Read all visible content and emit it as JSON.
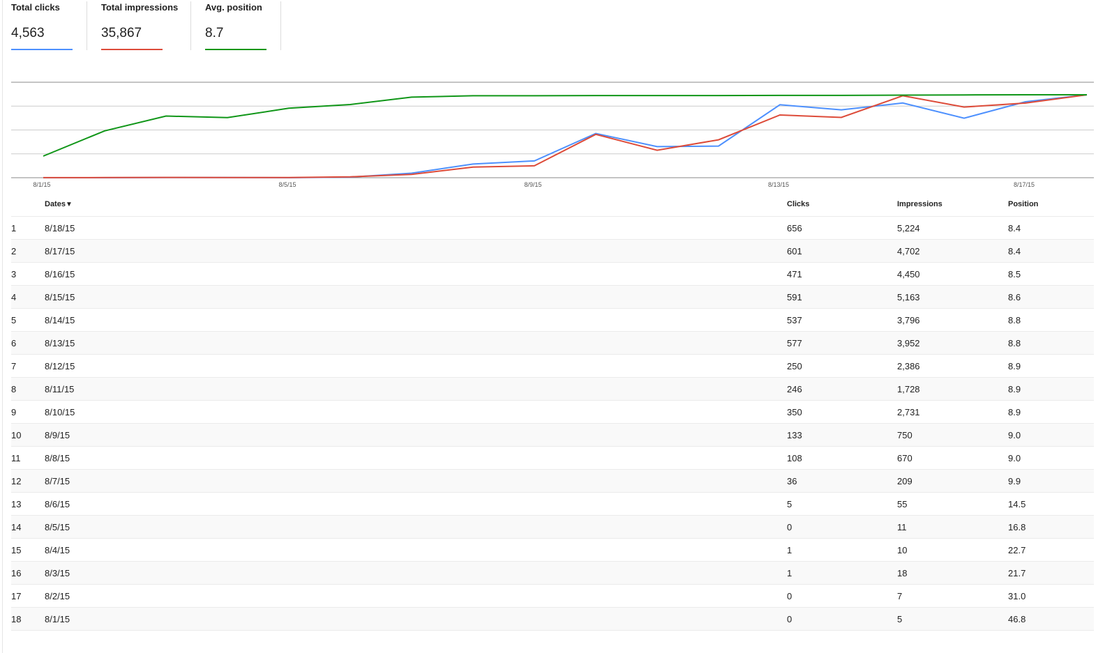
{
  "metrics": [
    {
      "label": "Total clicks",
      "value": "4,563",
      "color": "#4d90fe"
    },
    {
      "label": "Total impressions",
      "value": "35,867",
      "color": "#dd4b39"
    },
    {
      "label": "Avg. position",
      "value": "8.7",
      "color": "#109618"
    }
  ],
  "table": {
    "headers": {
      "dates": "Dates",
      "sort_indicator": "▼",
      "clicks": "Clicks",
      "impressions": "Impressions",
      "position": "Position"
    },
    "rows": [
      {
        "idx": "1",
        "date": "8/18/15",
        "clicks": "656",
        "impressions": "5,224",
        "position": "8.4"
      },
      {
        "idx": "2",
        "date": "8/17/15",
        "clicks": "601",
        "impressions": "4,702",
        "position": "8.4"
      },
      {
        "idx": "3",
        "date": "8/16/15",
        "clicks": "471",
        "impressions": "4,450",
        "position": "8.5"
      },
      {
        "idx": "4",
        "date": "8/15/15",
        "clicks": "591",
        "impressions": "5,163",
        "position": "8.6"
      },
      {
        "idx": "5",
        "date": "8/14/15",
        "clicks": "537",
        "impressions": "3,796",
        "position": "8.8"
      },
      {
        "idx": "6",
        "date": "8/13/15",
        "clicks": "577",
        "impressions": "3,952",
        "position": "8.8"
      },
      {
        "idx": "7",
        "date": "8/12/15",
        "clicks": "250",
        "impressions": "2,386",
        "position": "8.9"
      },
      {
        "idx": "8",
        "date": "8/11/15",
        "clicks": "246",
        "impressions": "1,728",
        "position": "8.9"
      },
      {
        "idx": "9",
        "date": "8/10/15",
        "clicks": "350",
        "impressions": "2,731",
        "position": "8.9"
      },
      {
        "idx": "10",
        "date": "8/9/15",
        "clicks": "133",
        "impressions": "750",
        "position": "9.0"
      },
      {
        "idx": "11",
        "date": "8/8/15",
        "clicks": "108",
        "impressions": "670",
        "position": "9.0"
      },
      {
        "idx": "12",
        "date": "8/7/15",
        "clicks": "36",
        "impressions": "209",
        "position": "9.9"
      },
      {
        "idx": "13",
        "date": "8/6/15",
        "clicks": "5",
        "impressions": "55",
        "position": "14.5"
      },
      {
        "idx": "14",
        "date": "8/5/15",
        "clicks": "0",
        "impressions": "11",
        "position": "16.8"
      },
      {
        "idx": "15",
        "date": "8/4/15",
        "clicks": "1",
        "impressions": "10",
        "position": "22.7"
      },
      {
        "idx": "16",
        "date": "8/3/15",
        "clicks": "1",
        "impressions": "18",
        "position": "21.7"
      },
      {
        "idx": "17",
        "date": "8/2/15",
        "clicks": "0",
        "impressions": "7",
        "position": "31.0"
      },
      {
        "idx": "18",
        "date": "8/1/15",
        "clicks": "0",
        "impressions": "5",
        "position": "46.8"
      }
    ]
  },
  "chart_data": {
    "type": "line",
    "x": [
      "8/1/15",
      "8/2/15",
      "8/3/15",
      "8/4/15",
      "8/5/15",
      "8/6/15",
      "8/7/15",
      "8/8/15",
      "8/9/15",
      "8/10/15",
      "8/11/15",
      "8/12/15",
      "8/13/15",
      "8/14/15",
      "8/15/15",
      "8/16/15",
      "8/17/15",
      "8/18/15"
    ],
    "x_tick_labels": [
      "8/1/15",
      "8/5/15",
      "8/9/15",
      "8/13/15",
      "8/17/15"
    ],
    "series": [
      {
        "color": "#4d90fe",
        "values": [
          0,
          0,
          1,
          1,
          0,
          5,
          36,
          108,
          133,
          350,
          246,
          250,
          577,
          537,
          591,
          471,
          601,
          656
        ]
      },
      {
        "color": "#dd4b39",
        "values": [
          5,
          7,
          18,
          10,
          11,
          55,
          209,
          670,
          750,
          2731,
          1728,
          2386,
          3952,
          3796,
          5163,
          4450,
          4702,
          5224
        ]
      },
      {
        "color": "#109618",
        "values": [
          46.8,
          31.0,
          21.7,
          22.7,
          16.8,
          14.5,
          9.9,
          9.0,
          9.0,
          8.9,
          8.9,
          8.9,
          8.8,
          8.8,
          8.6,
          8.5,
          8.4,
          8.4
        ]
      }
    ],
    "grid": true,
    "legend": "none"
  }
}
